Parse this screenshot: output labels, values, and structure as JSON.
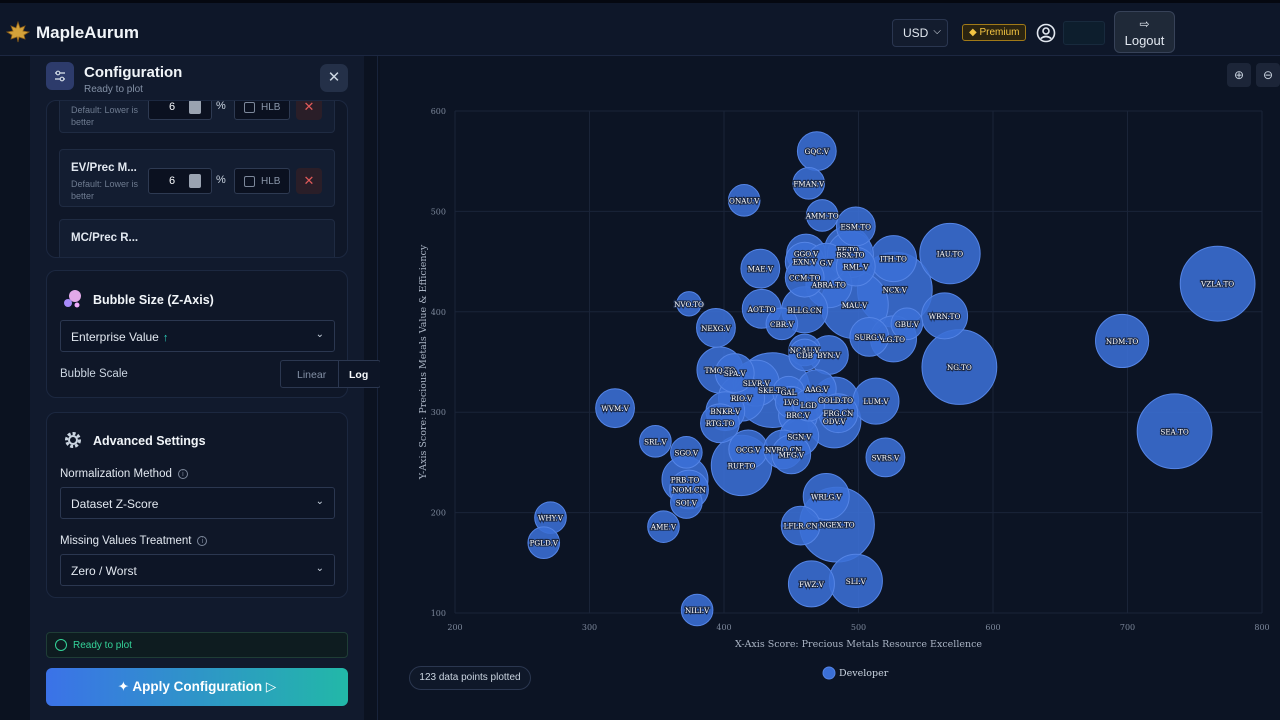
{
  "app": {
    "brand": "MapleAurum"
  },
  "header": {
    "currency": "USD",
    "premium": "Premium",
    "logout": "Logout"
  },
  "config": {
    "title": "Configuration",
    "subtitle": "Ready to plot",
    "metrics": [
      {
        "name": "",
        "default": "Default: Lower is better",
        "value": "6",
        "unit": "%",
        "hlb": "HLB"
      },
      {
        "name": "EV/Prec M...",
        "default": "Default: Lower is better",
        "value": "6",
        "unit": "%",
        "hlb": "HLB"
      },
      {
        "name": "MC/Prec R..."
      }
    ]
  },
  "bubble": {
    "title": "Bubble Size (Z-Axis)",
    "selected": "Enterprise Value",
    "arrow": "↑",
    "scale_label": "Bubble Scale",
    "scale_options": [
      "Linear",
      "Log"
    ],
    "scale_selected": "Log"
  },
  "advanced": {
    "title": "Advanced Settings",
    "norm_label": "Normalization Method",
    "norm_value": "Dataset Z-Score",
    "missing_label": "Missing Values Treatment",
    "missing_value": "Zero / Worst"
  },
  "status": {
    "ready": "Ready to plot",
    "apply": "Apply Configuration"
  },
  "plot": {
    "points_badge": "123 data points plotted",
    "legend": "Developer"
  },
  "colors": {
    "bubble": "#3b6fd6",
    "bubble_stroke": "#5585e6",
    "accent_teal": "#22b8a8",
    "ready_green": "#34d399",
    "premium_gold": "#f5c542"
  },
  "chart_data": {
    "type": "scatter",
    "xlabel": "X-Axis Score: Precious Metals Resource Excellence",
    "ylabel": "Y-Axis Score: Precious Metals Value & Efficiency",
    "xlim": [
      200,
      800
    ],
    "ylim": [
      100,
      600
    ],
    "xticks": [
      200,
      300,
      400,
      500,
      600,
      700,
      800
    ],
    "yticks": [
      100,
      200,
      300,
      400,
      500,
      600
    ],
    "grid": true,
    "legend_position": "bottom",
    "series": [
      {
        "name": "Developer",
        "points": [
          {
            "label": "GQC.V",
            "x": 469,
            "y": 560,
            "z": 4
          },
          {
            "label": "FMAN.V",
            "x": 463,
            "y": 528,
            "z": 3
          },
          {
            "label": "ONAU.V",
            "x": 415,
            "y": 511,
            "z": 3
          },
          {
            "label": "AMM.TO",
            "x": 473,
            "y": 496,
            "z": 3
          },
          {
            "label": "ESM.TO",
            "x": 498,
            "y": 485,
            "z": 4
          },
          {
            "label": "IAU.TO",
            "x": 568,
            "y": 458,
            "z": 7
          },
          {
            "label": "ITH.TO",
            "x": 526,
            "y": 453,
            "z": 5
          },
          {
            "label": "VZLA.TO",
            "x": 767,
            "y": 428,
            "z": 9
          },
          {
            "label": "FF.TO",
            "x": 492,
            "y": 462,
            "z": 5
          },
          {
            "label": "GGO.V",
            "x": 461,
            "y": 458,
            "z": 4
          },
          {
            "label": "BSX.TO",
            "x": 494,
            "y": 457,
            "z": 5
          },
          {
            "label": "EXN.V",
            "x": 460,
            "y": 450,
            "z": 4
          },
          {
            "label": "G.V",
            "x": 476,
            "y": 449,
            "z": 4
          },
          {
            "label": "RML.V",
            "x": 498,
            "y": 445,
            "z": 4
          },
          {
            "label": "MAE.V",
            "x": 427,
            "y": 443,
            "z": 4
          },
          {
            "label": "CCM.TO",
            "x": 460,
            "y": 434,
            "z": 4
          },
          {
            "label": "ABRA.TO",
            "x": 478,
            "y": 427,
            "z": 5
          },
          {
            "label": "NCX.V",
            "x": 527,
            "y": 422,
            "z": 9
          },
          {
            "label": "NVO.TO",
            "x": 374,
            "y": 408,
            "z": 2
          },
          {
            "label": "AOT.TO",
            "x": 428,
            "y": 403,
            "z": 4
          },
          {
            "label": "BLLG.CN",
            "x": 460,
            "y": 402,
            "z": 5
          },
          {
            "label": "MAU.V",
            "x": 497,
            "y": 407,
            "z": 8
          },
          {
            "label": "WRN.TO",
            "x": 564,
            "y": 396,
            "z": 5
          },
          {
            "label": "NEXG.V",
            "x": 394,
            "y": 384,
            "z": 4
          },
          {
            "label": "CBR.V",
            "x": 443,
            "y": 388,
            "z": 3
          },
          {
            "label": "GBU.V",
            "x": 536,
            "y": 388,
            "z": 3
          },
          {
            "label": "SURG.V",
            "x": 508,
            "y": 375,
            "z": 4
          },
          {
            "label": "LG.TO",
            "x": 526,
            "y": 373,
            "z": 5
          },
          {
            "label": "NDM.TO",
            "x": 696,
            "y": 371,
            "z": 6
          },
          {
            "label": "NCAU.V",
            "x": 460,
            "y": 362,
            "z": 3
          },
          {
            "label": "CDB",
            "x": 460,
            "y": 357,
            "z": 3
          },
          {
            "label": "BYN.V",
            "x": 478,
            "y": 357,
            "z": 4
          },
          {
            "label": "NG.TO",
            "x": 575,
            "y": 345,
            "z": 9
          },
          {
            "label": "TMQ.TO",
            "x": 397,
            "y": 342,
            "z": 5
          },
          {
            "label": "SPA.V",
            "x": 408,
            "y": 339,
            "z": 4
          },
          {
            "label": "SLVR.V",
            "x": 424,
            "y": 329,
            "z": 5
          },
          {
            "label": "SKE.TO",
            "x": 436,
            "y": 322,
            "z": 9
          },
          {
            "label": "GAL",
            "x": 448,
            "y": 320,
            "z": 3
          },
          {
            "label": "AAG.V",
            "x": 469,
            "y": 323,
            "z": 4
          },
          {
            "label": "RIO.V",
            "x": 413,
            "y": 314,
            "z": 5
          },
          {
            "label": "LVG",
            "x": 450,
            "y": 310,
            "z": 3
          },
          {
            "label": "GOLD.TO",
            "x": 483,
            "y": 312,
            "z": 5
          },
          {
            "label": "LUM.V",
            "x": 513,
            "y": 311,
            "z": 5
          },
          {
            "label": "LGD",
            "x": 463,
            "y": 307,
            "z": 3
          },
          {
            "label": "WVM.V",
            "x": 319,
            "y": 304,
            "z": 4
          },
          {
            "label": "BNKR.V",
            "x": 401,
            "y": 301,
            "z": 4
          },
          {
            "label": "FRG.CN",
            "x": 485,
            "y": 299,
            "z": 4
          },
          {
            "label": "BRC.V",
            "x": 455,
            "y": 297,
            "z": 4
          },
          {
            "label": "ODV.V",
            "x": 482,
            "y": 291,
            "z": 6
          },
          {
            "label": "RTG.TO",
            "x": 397,
            "y": 289,
            "z": 4
          },
          {
            "label": "SGN.V",
            "x": 456,
            "y": 276,
            "z": 4
          },
          {
            "label": "SRL.V",
            "x": 349,
            "y": 271,
            "z": 3
          },
          {
            "label": "OCG.V",
            "x": 418,
            "y": 263,
            "z": 4
          },
          {
            "label": "NVRO.CN",
            "x": 444,
            "y": 263,
            "z": 4
          },
          {
            "label": "SGO.V",
            "x": 372,
            "y": 260,
            "z": 3
          },
          {
            "label": "MFG.V",
            "x": 450,
            "y": 258,
            "z": 4
          },
          {
            "label": "SVRS.V",
            "x": 520,
            "y": 255,
            "z": 4
          },
          {
            "label": "RUP.TO",
            "x": 413,
            "y": 247,
            "z": 7
          },
          {
            "label": "PRB.TO",
            "x": 371,
            "y": 233,
            "z": 5
          },
          {
            "label": "NOM.CN",
            "x": 374,
            "y": 223,
            "z": 4
          },
          {
            "label": "SOI.V",
            "x": 372,
            "y": 210,
            "z": 3
          },
          {
            "label": "WRLG.V",
            "x": 476,
            "y": 216,
            "z": 5
          },
          {
            "label": "WHY.V",
            "x": 271,
            "y": 195,
            "z": 3
          },
          {
            "label": "NGEX.TO",
            "x": 484,
            "y": 188,
            "z": 9
          },
          {
            "label": "LFLR.CN",
            "x": 457,
            "y": 187,
            "z": 4
          },
          {
            "label": "AME.V",
            "x": 355,
            "y": 186,
            "z": 3
          },
          {
            "label": "PGLD.V",
            "x": 266,
            "y": 170,
            "z": 3
          },
          {
            "label": "FWZ.V",
            "x": 465,
            "y": 129,
            "z": 5
          },
          {
            "label": "SLI.V",
            "x": 498,
            "y": 132,
            "z": 6
          },
          {
            "label": "NILI.V",
            "x": 380,
            "y": 103,
            "z": 3
          },
          {
            "label": "SEA.TO",
            "x": 735,
            "y": 281,
            "z": 9
          }
        ]
      }
    ]
  }
}
